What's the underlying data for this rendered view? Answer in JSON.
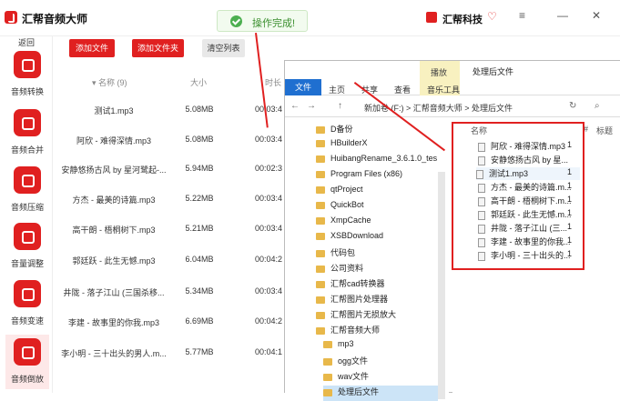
{
  "app": {
    "title": "汇帮音频大师",
    "brand": "汇帮科技"
  },
  "toast": {
    "message": "操作完成!"
  },
  "sidebar": {
    "back": "返回",
    "items": [
      {
        "label": "音频转换"
      },
      {
        "label": "音频合并"
      },
      {
        "label": "音频压缩"
      },
      {
        "label": "音量调整"
      },
      {
        "label": "音频变速"
      },
      {
        "label": "音频倒放"
      }
    ]
  },
  "toolbar": {
    "add_file": "添加文件",
    "add_folder": "添加文件夹",
    "clear": "清空列表"
  },
  "columns": {
    "name": "名称 (9)",
    "size": "大小",
    "duration": "时长"
  },
  "files": [
    {
      "name": "测试1.mp3",
      "size": "5.08MB",
      "duration": "00:03:4"
    },
    {
      "name": "阿欣 - 难得深情.mp3",
      "size": "5.08MB",
      "duration": "00:03:4"
    },
    {
      "name": "安静悠扬古风 by 星河鹭起-...",
      "size": "5.94MB",
      "duration": "00:02:3"
    },
    {
      "name": "方杰 - 最美的诗篇.mp3",
      "size": "5.22MB",
      "duration": "00:03:4"
    },
    {
      "name": "高干朗 - 梧桐树下.mp3",
      "size": "5.21MB",
      "duration": "00:03:4"
    },
    {
      "name": "郭廷跃 - 此生无憾.mp3",
      "size": "6.04MB",
      "duration": "00:04:2"
    },
    {
      "name": "井陇 - 落子江山 (三国杀移...",
      "size": "5.34MB",
      "duration": "00:03:4"
    },
    {
      "name": "李建 - 故事里的你我.mp3",
      "size": "6.69MB",
      "duration": "00:04:2"
    },
    {
      "name": "李小明 - 三十出头的男人.m...",
      "size": "5.77MB",
      "duration": "00:04:1"
    }
  ],
  "explorer": {
    "ribbon_play": "播放",
    "folder_title": "处理后文件",
    "tabs": [
      "文件",
      "主页",
      "共享",
      "查看",
      "音乐工具"
    ],
    "address": "新加卷 (F:) > 汇帮音频大师 > 处理后文件",
    "col_name": "名称",
    "col_num": "#",
    "col_title": "标题",
    "tree": [
      "D备份",
      "HBuilderX",
      "HuibangRename_3.6.1.0_tes",
      "Program Files (x86)",
      "qtProject",
      "QuickBot",
      "XmpCache",
      "XSBDownload",
      "代码包",
      "公司资料",
      "汇帮cad转换器",
      "汇帮图片处理器",
      "汇帮图片无损放大",
      "汇帮音频大师",
      "mp3",
      "ogg文件",
      "wav文件",
      "处理后文件"
    ],
    "files": [
      {
        "name": "阿欣 - 难得深情.mp3",
        "num": "1"
      },
      {
        "name": "安静悠扬古风 by 星...",
        "num": "1"
      },
      {
        "name": "测试1.mp3",
        "num": "1"
      },
      {
        "name": "方杰 - 最美的诗篇.m...",
        "num": "1"
      },
      {
        "name": "高干朗 - 梧桐树下.m...",
        "num": "1"
      },
      {
        "name": "郭廷跃 - 此生无憾.m...",
        "num": "1"
      },
      {
        "name": "井陇 - 落子江山 (三...",
        "num": "1"
      },
      {
        "name": "李建 - 故事里的你我...",
        "num": "1"
      },
      {
        "name": "李小明 - 三十出头的...",
        "num": "1"
      }
    ]
  },
  "colors": {
    "accent": "#e02020",
    "success": "#4caf50"
  }
}
